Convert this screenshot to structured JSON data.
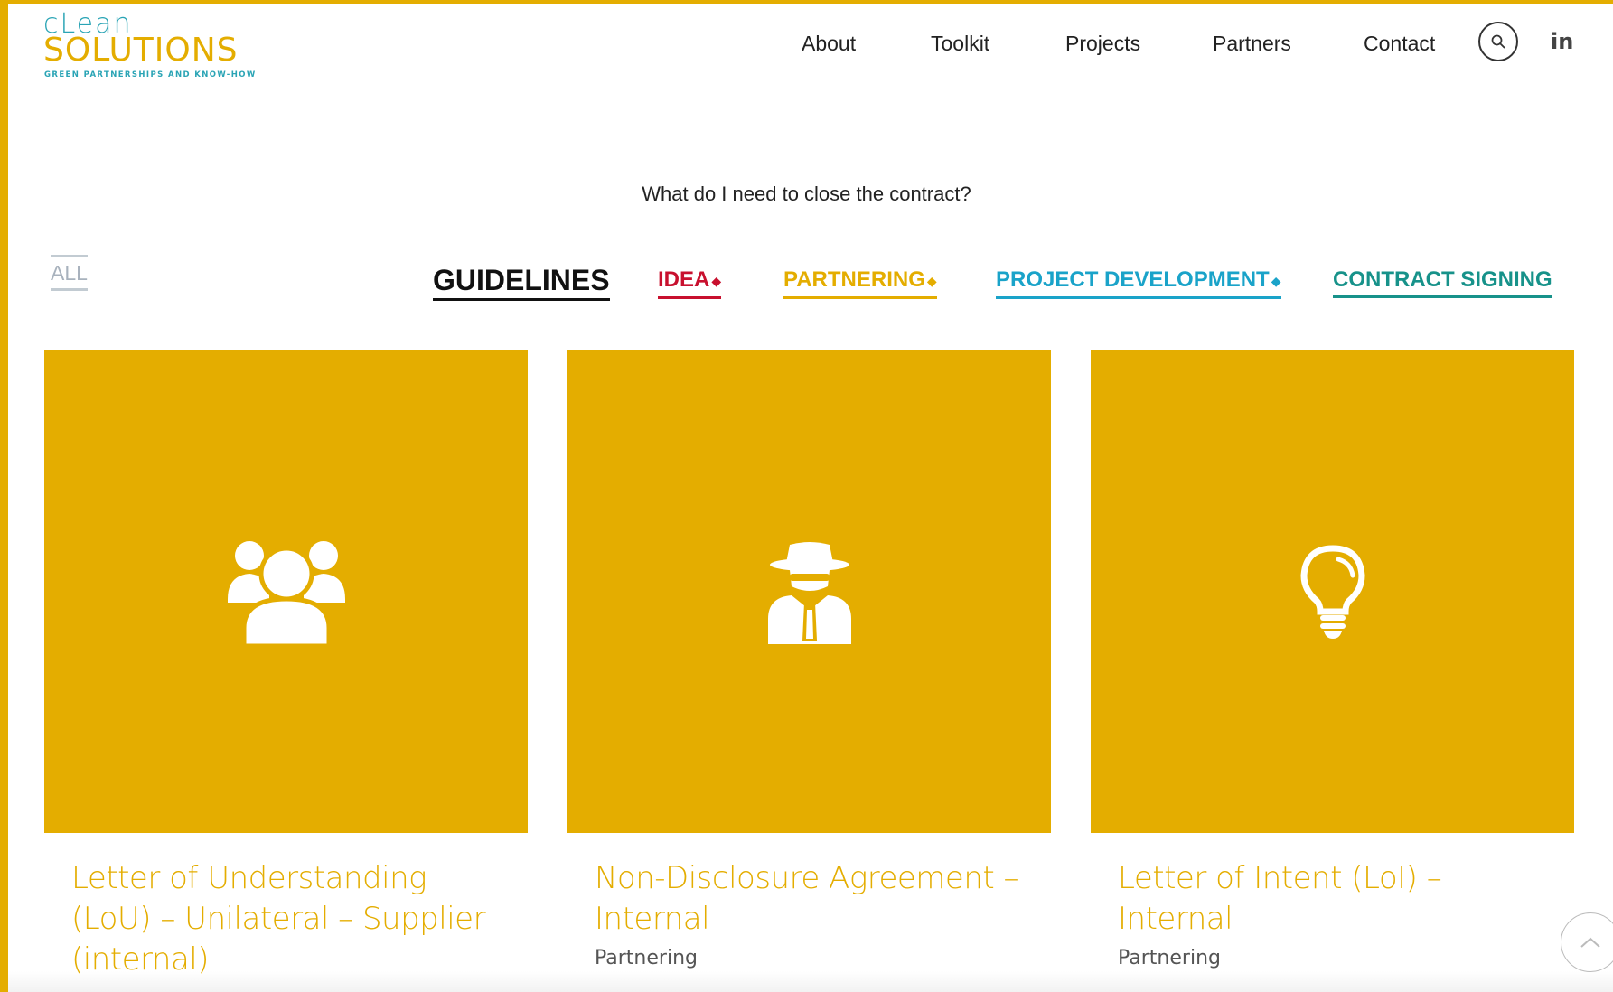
{
  "colors": {
    "brand_yellow": "#e4ad00",
    "brand_teal": "#2aa4b5",
    "idea_red": "#c8102e",
    "contract_teal": "#17928a"
  },
  "logo": {
    "line1": "cLean",
    "line2": "SOLUTIONS",
    "tagline": "GREEN PARTNERSHIPS AND KNOW-HOW"
  },
  "nav": {
    "items": [
      {
        "label": "About"
      },
      {
        "label": "Toolkit"
      },
      {
        "label": "Projects"
      },
      {
        "label": "Partners"
      },
      {
        "label": "Contact"
      }
    ],
    "search_icon": "search-icon",
    "linkedin_label": "in"
  },
  "subtitle": "What do I need to close the contract?",
  "filters": {
    "all": "ALL",
    "guidelines": "GUIDELINES",
    "idea": "IDEA",
    "partnering": "PARTNERING",
    "project_development": "PROJECT DEVELOPMENT",
    "contract_signing": "CONTRACT SIGNING"
  },
  "cards": [
    {
      "icon": "users-group-icon",
      "title": "Letter of Understanding (LoU) – Unilateral – Supplier (internal)",
      "category": ""
    },
    {
      "icon": "spy-agent-icon",
      "title": "Non-Disclosure Agreement – Internal",
      "category": "Partnering"
    },
    {
      "icon": "lightbulb-icon",
      "title": "Letter of Intent (LoI) – Internal",
      "category": "Partnering"
    }
  ]
}
